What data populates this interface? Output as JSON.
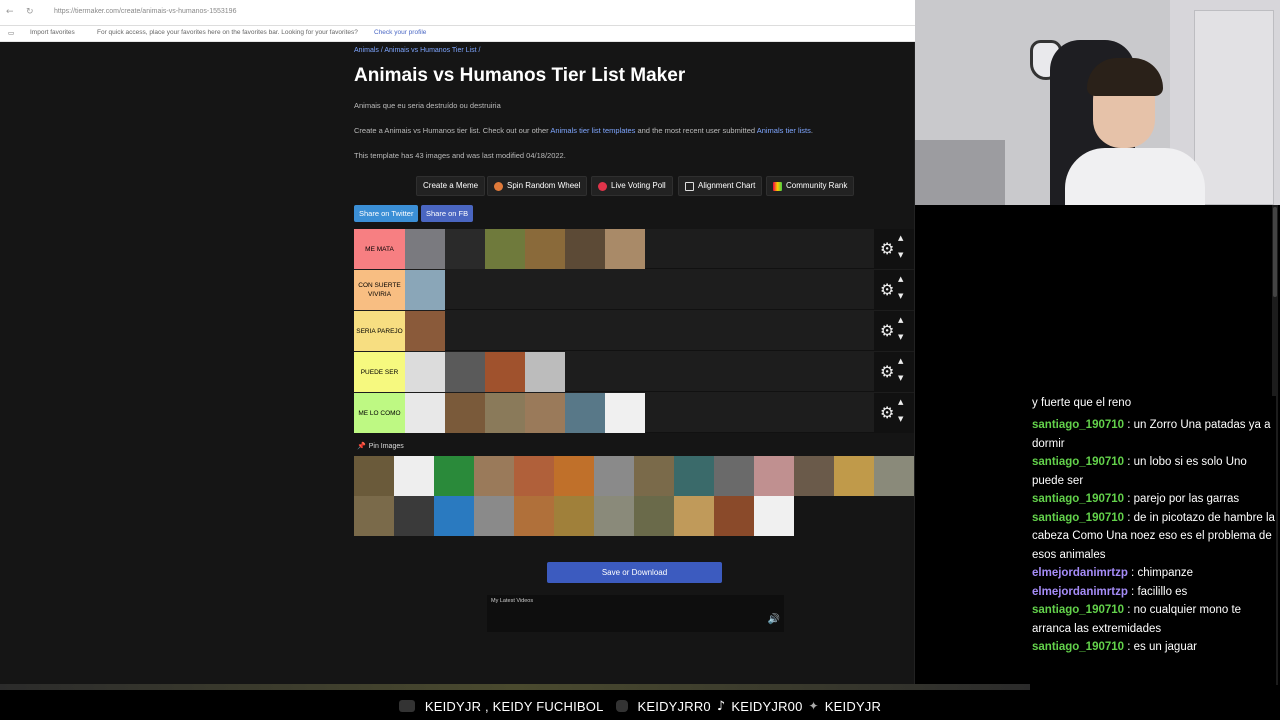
{
  "browser": {
    "url": "https://tiermaker.com/create/animais-vs-humanos-1553196",
    "bookmarks_label": "Import favorites",
    "bookmarks_hint": "For quick access, place your favorites here on the favorites bar. Looking for your favorites?",
    "bookmarks_link": "Check your profile"
  },
  "page": {
    "breadcrumb": "Animals / Animais vs Humanos Tier List /",
    "title": "Animais vs Humanos Tier List Maker",
    "subtitle": "Animais que eu seria destruído ou destruiria",
    "desc_pre": "Create a Animais vs Humanos tier list. Check out our other",
    "desc_link1": "Animals tier list templates",
    "desc_mid": "and the most recent user submitted",
    "desc_link2": "Animals tier lists",
    "desc_end": ".",
    "meta": "This template has 43 images and was last modified 04/18/2022.",
    "actions": [
      {
        "label": "Create a Meme",
        "icon_color": ""
      },
      {
        "label": "Spin Random Wheel",
        "icon_color": "#e07a3a"
      },
      {
        "label": "Live Voting Poll",
        "icon_color": "#e0344a"
      },
      {
        "label": "Alignment Chart",
        "icon_color": "#dddddd"
      },
      {
        "label": "Community Rank",
        "icon_color": "#c8c830"
      }
    ],
    "share_twitter": "Share on Twitter",
    "share_fb": "Share on FB",
    "tiers": [
      {
        "label": "ME MATA",
        "color": "#f77f82",
        "tiles": [
          "#7a7a7f",
          "#2a2a2a",
          "#6f7a3c",
          "#8a6a3a",
          "#5c4a36",
          "#a98a68"
        ]
      },
      {
        "label": "CON SUERTE VIVIRIA",
        "color": "#f8be82",
        "tiles": [
          "#8aa6b8"
        ]
      },
      {
        "label": "SERIA PAREJO",
        "color": "#f7de81",
        "tiles": [
          "#8a5a3a"
        ]
      },
      {
        "label": "PUEDE SER",
        "color": "#f6f97f",
        "tiles": [
          "#dcdcdc",
          "#5a5a5a",
          "#a0522d",
          "#bcbcbc"
        ]
      },
      {
        "label": "ME LO COMO",
        "color": "#bef983",
        "tiles": [
          "#e8e8e8",
          "#7a5a3a",
          "#8a7a5a",
          "#9a7a5a",
          "#587888",
          "#f0f0f0"
        ]
      }
    ],
    "pin_label": "Pin Images",
    "pool_row1": [
      "#6a5a3a",
      "#eeeeee",
      "#2a8a3a",
      "#9a7a5a",
      "#b0603a",
      "#c0702a",
      "#8a8a8a",
      "#7a6a4a",
      "#3a6a6a",
      "#6a6a6a",
      "#c09090",
      "#6a5a4a",
      "#c09a4a",
      "#8a8a7a"
    ],
    "pool_row2": [
      "#7a6a4a",
      "#3a3a3a",
      "#2a7ac0",
      "#8a8a8a",
      "#b0703a",
      "#a0803a",
      "#8a8a7a",
      "#6a6a4a",
      "#c09a5a",
      "#8a4a2a",
      "#f0f0f0"
    ],
    "save_label": "Save or Download",
    "video_title": "My Latest Videos"
  },
  "chat": {
    "top_line": "y fuerte que el reno",
    "messages": [
      {
        "user": "santiago_190710",
        "color": "green",
        "text": "un Zorro Una patadas ya a dormir"
      },
      {
        "user": "santiago_190710",
        "color": "green",
        "text": "un lobo si es solo Uno puede ser"
      },
      {
        "user": "santiago_190710",
        "color": "green",
        "text": "parejo por las garras"
      },
      {
        "user": "santiago_190710",
        "color": "green",
        "text": "de in picotazo de hambre la cabeza Como Una noez eso es el problema de esos animales"
      },
      {
        "user": "elmejordanimrtzp",
        "color": "purple",
        "text": "chimpanze"
      },
      {
        "user": "elmejordanimrtzp",
        "color": "purple",
        "text": "facilillo es"
      },
      {
        "user": "santiago_190710",
        "color": "green",
        "text": "no cualquier mono te arranca las extremidades"
      },
      {
        "user": "santiago_190710",
        "color": "green",
        "text": "es un jaguar"
      }
    ]
  },
  "socials": {
    "s1": "KEIDYJR , KEIDY FUCHIBOL",
    "s2": "KEIDYJRR0",
    "s3": "KEIDYJR00",
    "s4": "KEIDYJR"
  }
}
